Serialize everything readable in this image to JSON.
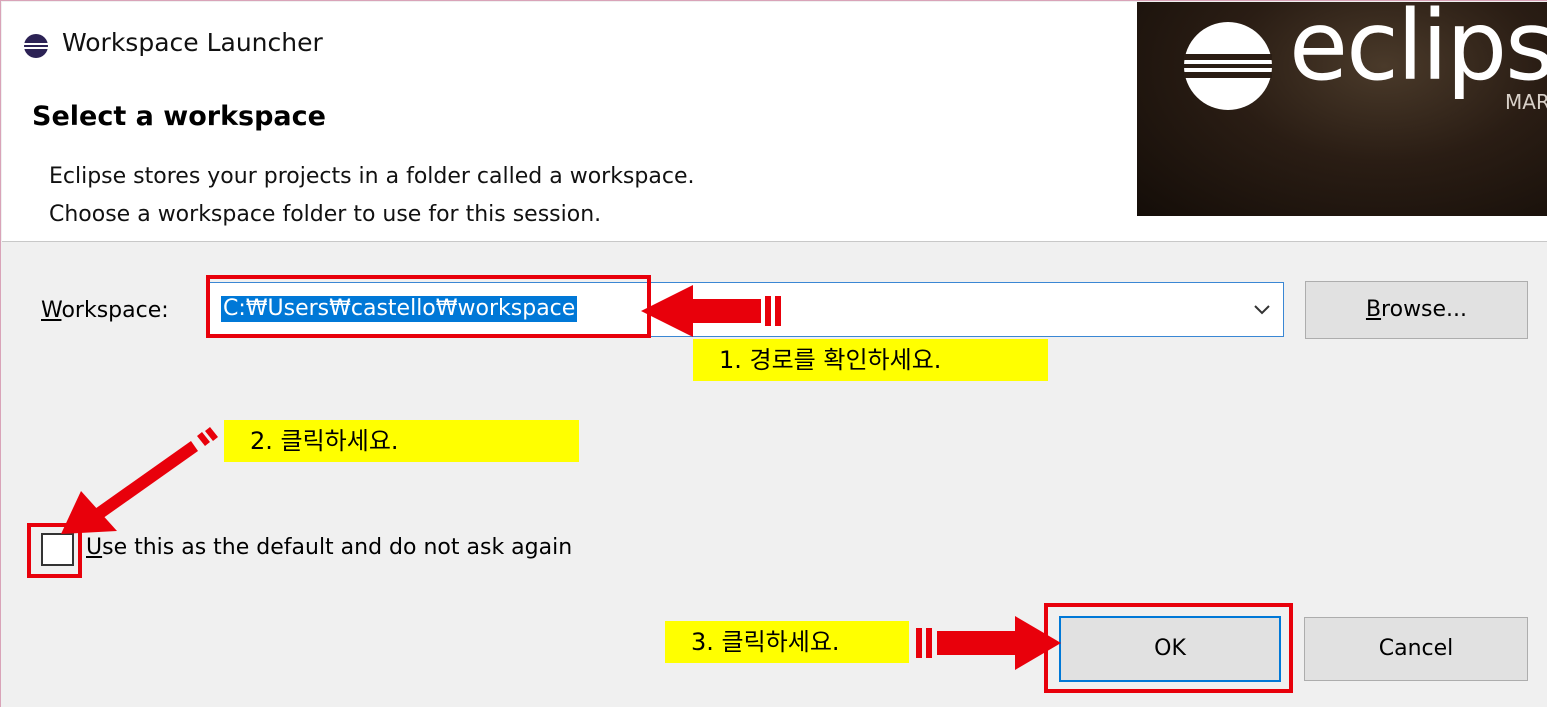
{
  "window": {
    "title": "Workspace Launcher",
    "icon": "eclipse-logo-icon"
  },
  "header": {
    "section_title": "Select a workspace",
    "desc_line1": "Eclipse stores your projects in a folder called a workspace.",
    "desc_line2": "Choose a workspace folder to use for this session.",
    "banner": {
      "logo_text": "eclipse",
      "sub_text": "MAR"
    }
  },
  "workspace": {
    "label_accel": "W",
    "label_rest": "orkspace:",
    "value": "C:₩Users₩castello₩workspace",
    "dropdown_icon": "chevron-down-icon",
    "browse_accel": "B",
    "browse_rest": "rowse..."
  },
  "options": {
    "default_checked": false,
    "default_accel": "U",
    "default_rest": "se this as the default and do not ask again"
  },
  "buttons": {
    "ok": "OK",
    "cancel": "Cancel"
  },
  "annotations": {
    "step1": "1. 경로를 확인하세요.",
    "step2": "2. 클릭하세요.",
    "step3": "3. 클릭하세요."
  },
  "colors": {
    "highlight": "#e8000b",
    "note_bg": "#ffff00",
    "selection": "#0078d7"
  }
}
